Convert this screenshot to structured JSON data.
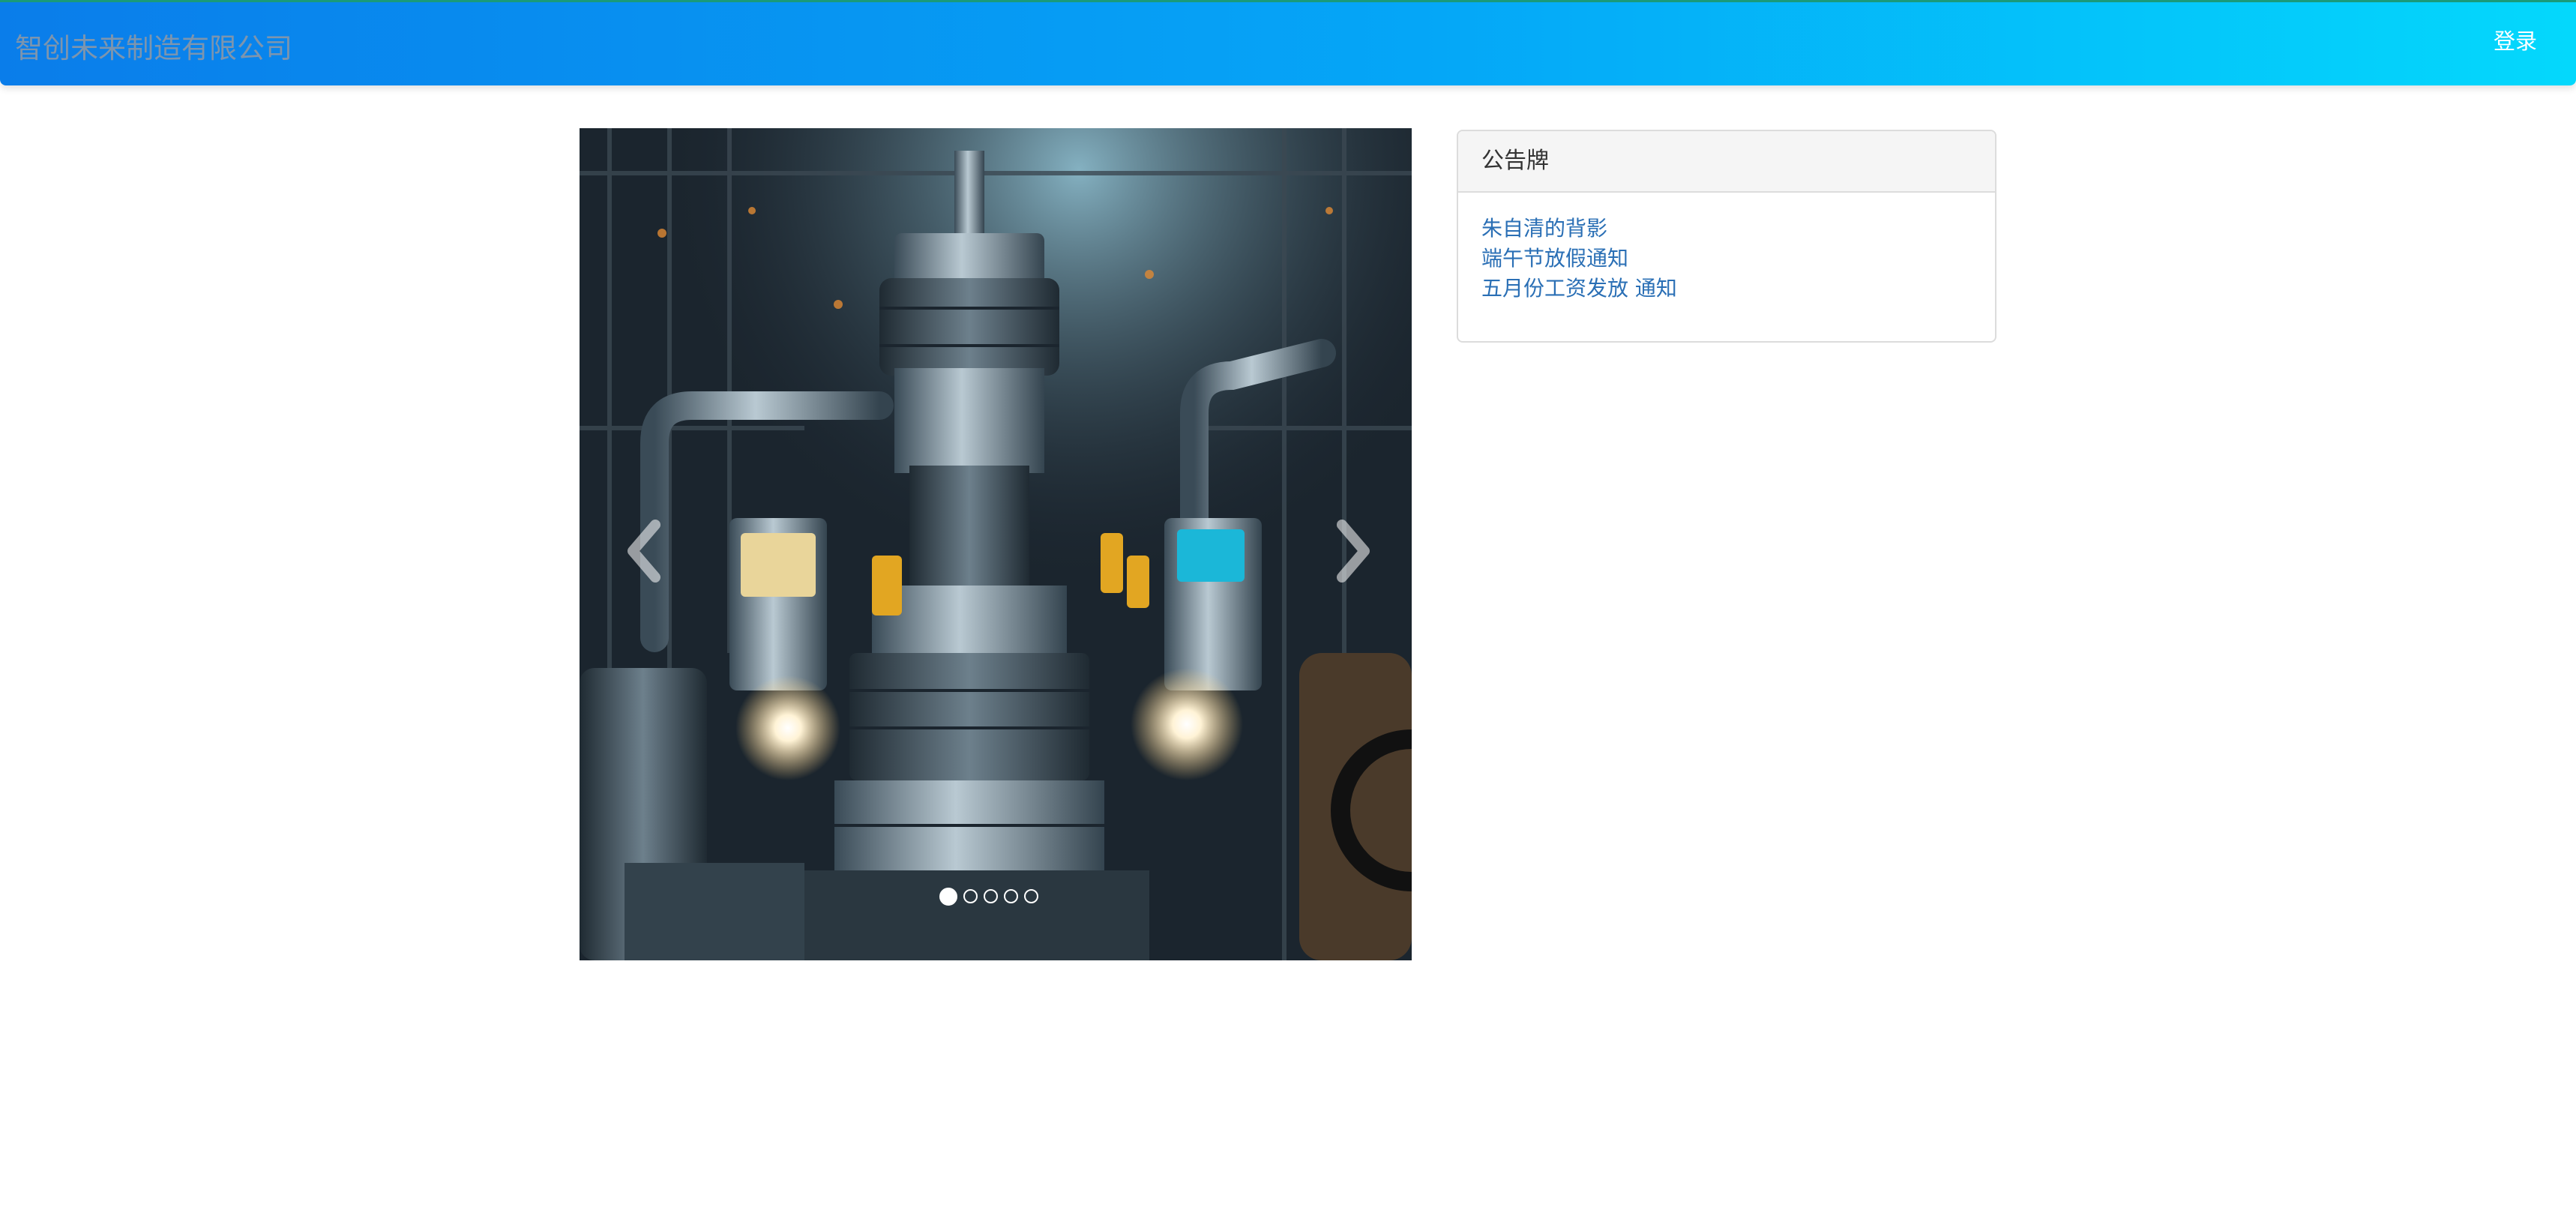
{
  "navbar": {
    "brand": "智创未来制造有限公司",
    "login_label": "登录"
  },
  "carousel": {
    "slide_count": 5,
    "active_index": 0,
    "prev_icon": "chevron-left-icon",
    "next_icon": "chevron-right-icon"
  },
  "notice_board": {
    "title": "公告牌",
    "items": [
      {
        "label": "朱自清的背影"
      },
      {
        "label": "端午节放假通知"
      },
      {
        "label": "五月份工资发放 通知"
      }
    ]
  },
  "colors": {
    "nav_gradient_start": "#0a7dea",
    "nav_gradient_end": "#04d8fc",
    "brand_text": "#7d95ae",
    "link": "#2a6fb5"
  }
}
